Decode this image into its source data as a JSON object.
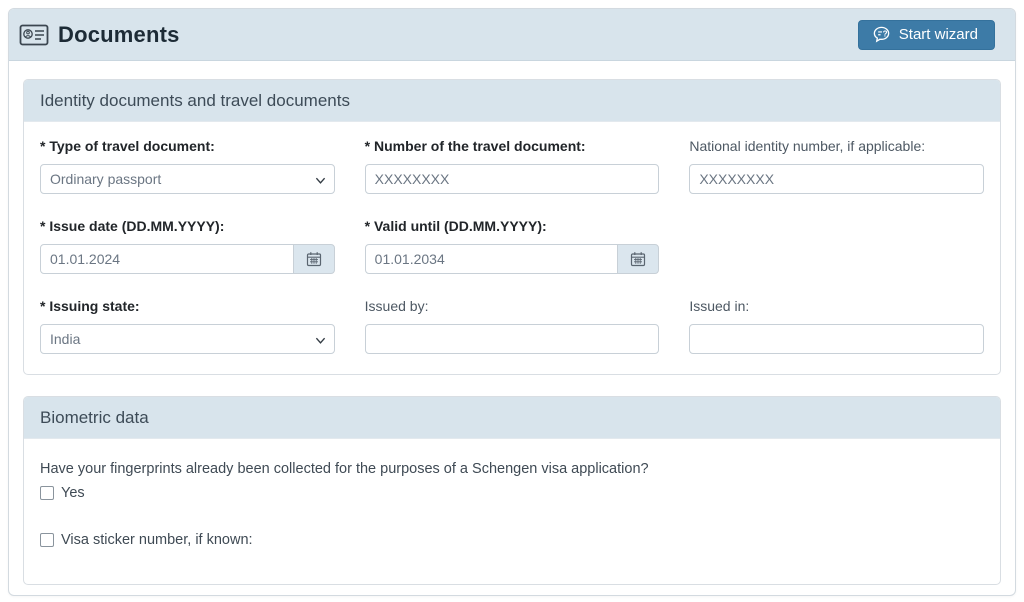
{
  "header": {
    "title": "Documents",
    "start_wizard_label": "Start wizard"
  },
  "identity_section": {
    "title": "Identity documents and travel documents",
    "fields": {
      "travel_doc_type": {
        "label": "* Type of travel document:",
        "value": "Ordinary passport",
        "required": true
      },
      "travel_doc_number": {
        "label": "* Number of the travel document:",
        "value": "XXXXXXXX",
        "required": true
      },
      "national_id_number": {
        "label": "National identity number, if applicable:",
        "value": "XXXXXXXX",
        "required": false
      },
      "issue_date": {
        "label": "* Issue date (DD.MM.YYYY):",
        "value": "01.01.2024",
        "required": true
      },
      "valid_until": {
        "label": "* Valid until (DD.MM.YYYY):",
        "value": "01.01.2034",
        "required": true
      },
      "issuing_state": {
        "label": "* Issuing state:",
        "value": "India",
        "required": true
      },
      "issued_by": {
        "label": "Issued by:",
        "value": "",
        "required": false
      },
      "issued_in": {
        "label": "Issued in:",
        "value": "",
        "required": false
      }
    }
  },
  "biometric_section": {
    "title": "Biometric data",
    "question": "Have your fingerprints already been collected for the purposes of a Schengen visa application?",
    "yes_label": "Yes",
    "yes_checked": false,
    "visa_sticker_label": "Visa sticker number, if known:",
    "visa_sticker_checked": false
  },
  "colors": {
    "header_bg": "#d8e4ec",
    "button_bg": "#3d7ba7",
    "button_border": "#34719c",
    "panel_border": "#d9dee3",
    "input_border": "#c8d0d7",
    "title_color": "#1d2b36",
    "input_text_color": "#6b7683"
  }
}
